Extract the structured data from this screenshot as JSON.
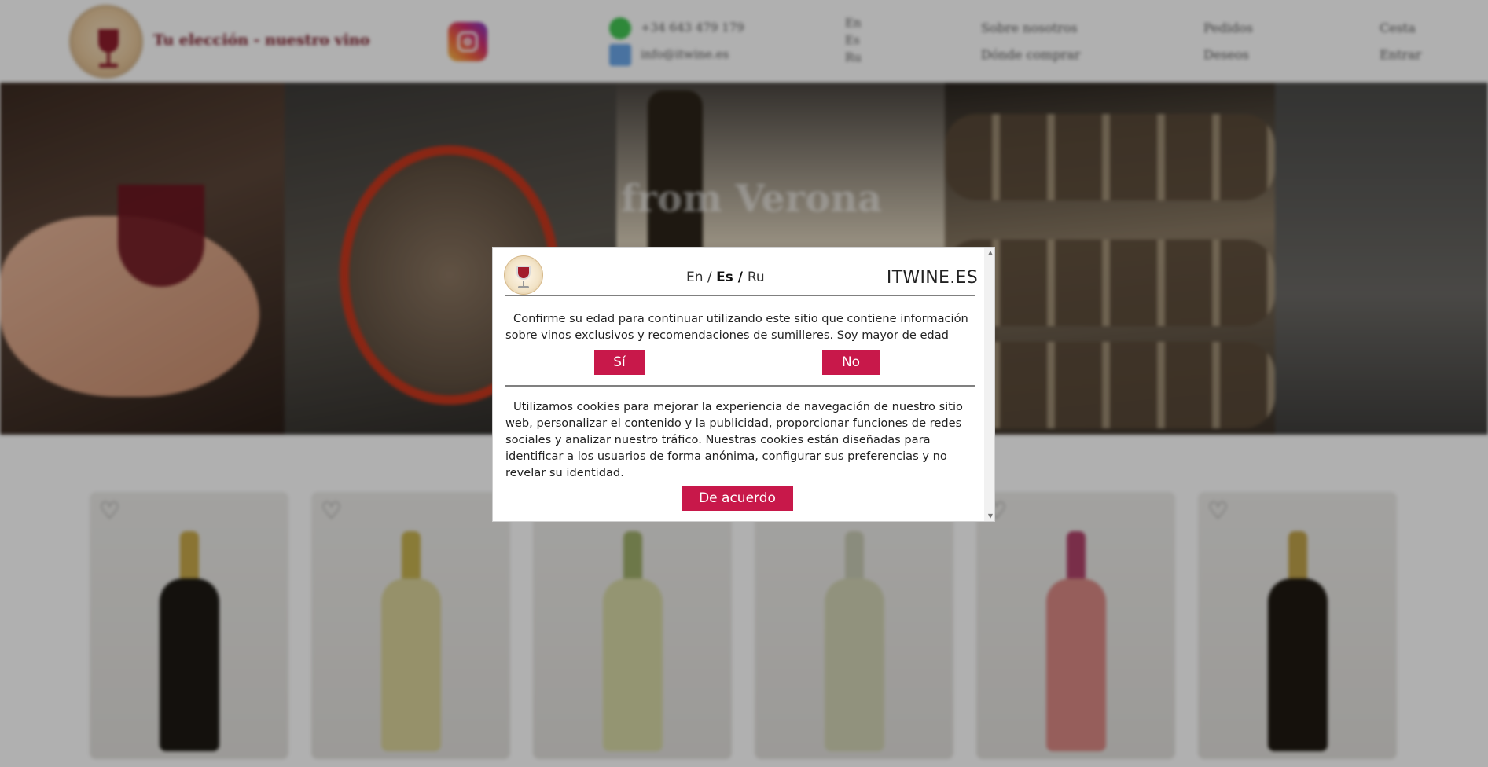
{
  "header": {
    "slogan": "Tu elección - nuestro vino",
    "phone": "+34 643 479 179",
    "email": "info@itwine.es",
    "languages": [
      "En",
      "Es",
      "Ru"
    ],
    "nav": {
      "about": "Sobre nosotros",
      "where_to_buy": "Dónde comprar",
      "orders": "Pedidos",
      "wishes": "Deseos",
      "cart": "Cesta",
      "login": "Entrar"
    }
  },
  "hero": {
    "text": "from Verona"
  },
  "products": [
    {
      "icon": "heart-icon",
      "bottle_color": "#1d1a14",
      "neck_color": "#c8a94a"
    },
    {
      "icon": "heart-icon",
      "bottle_color": "#d9d29a",
      "neck_color": "#c7b250"
    },
    {
      "icon": "heart-icon",
      "bottle_color": "#d7d8a6",
      "neck_color": "#9fae6a"
    },
    {
      "icon": "heart-icon",
      "bottle_color": "#d3d4b5",
      "neck_color": "#c9cbb5"
    },
    {
      "icon": "heart-icon",
      "bottle_color": "#d98985",
      "neck_color": "#b0436a"
    },
    {
      "icon": "heart-icon",
      "bottle_color": "#1f1a12",
      "neck_color": "#c0a24a"
    }
  ],
  "modal": {
    "languages": {
      "en": "En",
      "es": "Es",
      "ru": "Ru",
      "sep": " / "
    },
    "brand": "ITWINE.ES",
    "age_text": "Confirme su edad para continuar utilizando este sitio que contiene información sobre vinos exclusivos y recomendaciones de sumilleres. Soy mayor de edad",
    "yes_label": "Sí",
    "no_label": "No",
    "cookie_text": "Utilizamos cookies para mejorar la experiencia de navegación de nuestro sitio web, personalizar el contenido y la publicidad, proporcionar funciones de redes sociales y analizar nuestro tráfico. Nuestras cookies están diseñadas para identificar a los usuarios de forma anónima, configurar sus preferencias y no revelar su identidad.",
    "agree_label": "De acuerdo"
  },
  "colors": {
    "accent": "#c8184a",
    "overlay": "rgba(0,0,0,0.31)"
  }
}
